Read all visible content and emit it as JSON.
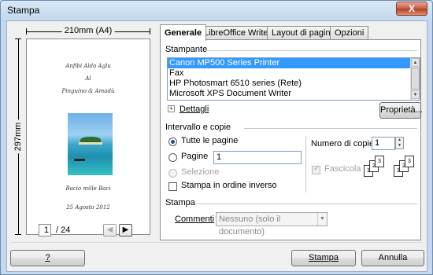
{
  "window": {
    "title": "Stampa",
    "close_glyph": "X"
  },
  "preview": {
    "width_label": "210mm (A4)",
    "height_label": "297mm",
    "page_lines": [
      "Anfibi Aldo Aglu",
      "Al",
      "Pinguino & Amadù",
      "Bacio mille Baci",
      "25 Agosto 2012"
    ],
    "current_page": "1",
    "total_pages": "/ 24"
  },
  "tabs": [
    "Generale",
    "LibreOffice Writer",
    "Layout di pagina",
    "Opzioni"
  ],
  "printer": {
    "section_label": "Stampante",
    "list": [
      "Canon MP500 Series Printer",
      "Fax",
      "HP Photosmart 6510 series (Rete)",
      "Microsoft XPS Document Writer"
    ],
    "selected_index": 0,
    "details_label": "Dettagli",
    "properties_button": "Proprietà..."
  },
  "range": {
    "section_label": "Intervallo e copie",
    "all_pages": "Tutte le pagine",
    "pages": "Pagine",
    "pages_value": "1",
    "selection": "Selezione",
    "reverse": "Stampa in ordine inverso",
    "copies_label": "Numero di copie",
    "copies_value": "1",
    "collate": "Fascicola",
    "sheet_labels": [
      "1",
      "2",
      "3"
    ]
  },
  "print_section": {
    "section_label": "Stampa",
    "comments_label": "Commenti",
    "comments_value": "Nessuno (solo il documento)"
  },
  "footer": {
    "help": "?",
    "print": "Stampa",
    "cancel": "Annulla"
  },
  "colors": {
    "selection": "#3399ff",
    "close": "#c75a3f"
  }
}
